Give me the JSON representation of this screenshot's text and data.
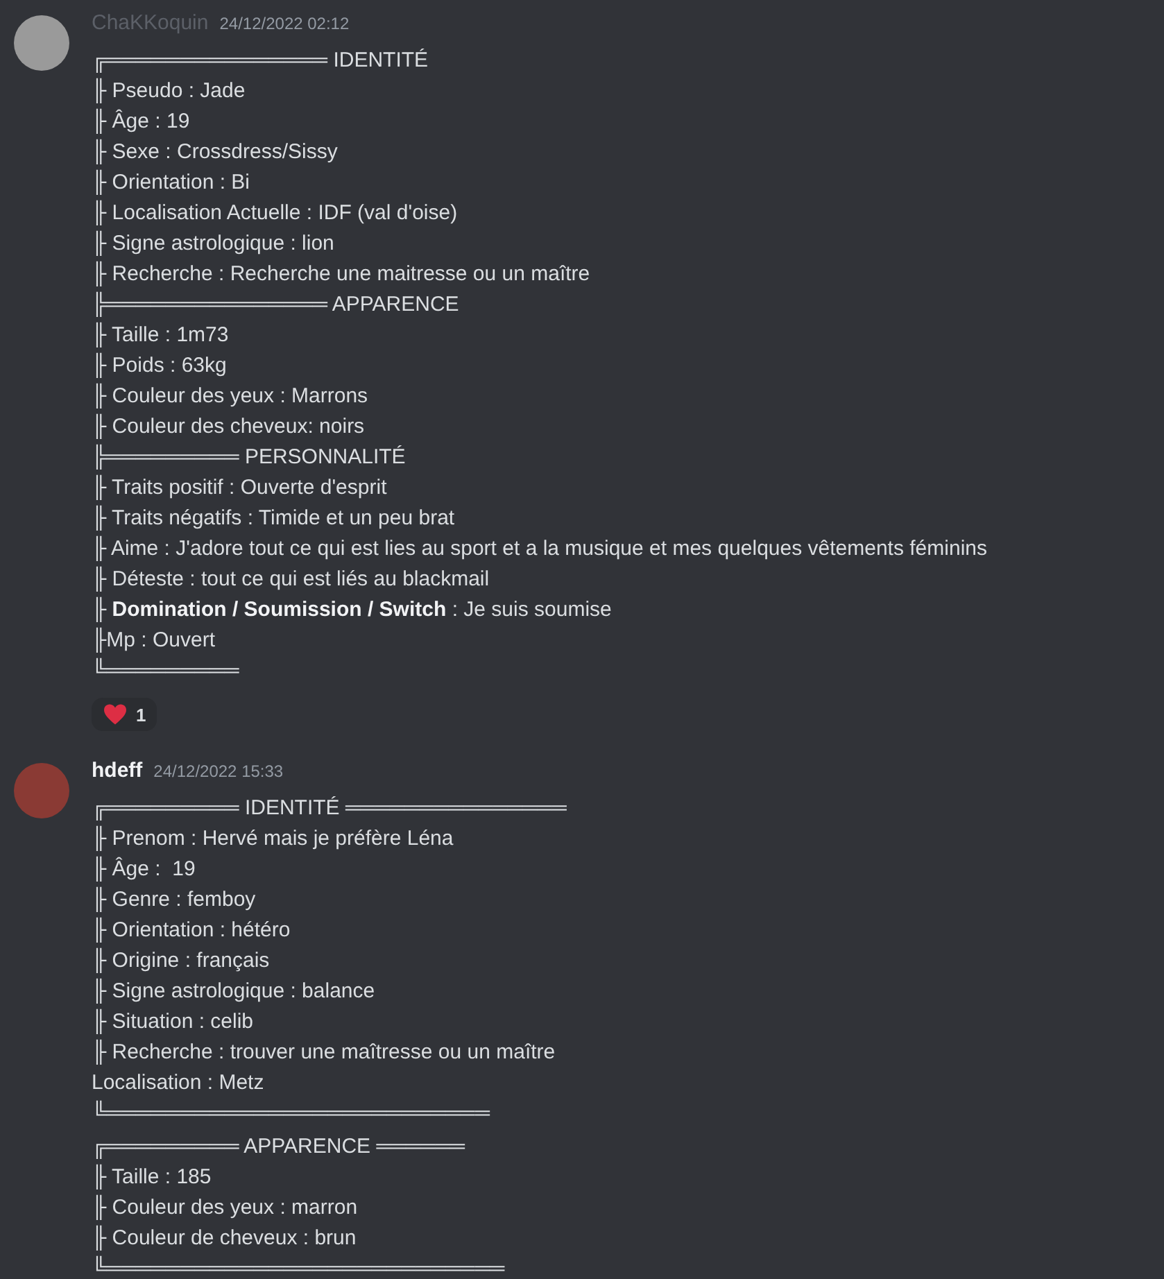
{
  "messages": [
    {
      "author": "ChaKKoquin",
      "author_dimmed": true,
      "timestamp": "24/12/2022 02:12",
      "paragraphs": [
        [
          "╔═══════════════ IDENTITÉ",
          "╟ Pseudo : Jade",
          "╟ Âge : 19",
          "╟ Sexe : Crossdress/Sissy",
          "╟ Orientation : Bi",
          "╟ Localisation Actuelle : IDF (val d'oise)",
          "╟ Signe astrologique : lion",
          "╟ Recherche : Recherche une maitresse ou un maître",
          "╠═══════════════ APPARENCE",
          "╟ Taille : 1m73",
          "╟ Poids : 63kg",
          "╟ Couleur des yeux : Marrons",
          "╟ Couleur des cheveux: noirs",
          "╠═════════ PERSONNALITÉ",
          "╟ Traits positif : Ouverte d'esprit",
          "╟ Traits négatifs : Timide et un peu brat",
          "╟ Aime : J'adore tout ce qui est lies au sport et a la musique et mes quelques vêtements féminins",
          "╟ Déteste : tout ce qui est liés au blackmail",
          "╟ **Domination / Soumission / Switch** : Je suis soumise",
          "╟Mp : Ouvert",
          "╚═════════"
        ]
      ],
      "reactions": [
        {
          "count": "1"
        }
      ]
    },
    {
      "author": "hdeff",
      "author_dimmed": false,
      "timestamp": "24/12/2022 15:33",
      "paragraphs": [
        [
          "╔═════════ IDENTITÉ ═══════════════",
          "╟ Prenom : Hervé mais je préfère Léna",
          "╟ Âge :  19",
          "╟ Genre : femboy",
          "╟ Orientation : hétéro",
          "╟ Origine : français",
          "╟ Signe astrologique : balance",
          "╟ Situation : celib",
          "╟ Recherche : trouver une maîtresse ou un maître",
          "Localisation : Metz",
          "╚══════════════════════════"
        ],
        [
          "╔═════════ APPARENCE ══════",
          "╟ Taille : 185",
          "╟ Couleur des yeux : marron",
          "╟ Couleur de cheveux : brun",
          "╚═══════════════════════════"
        ]
      ]
    }
  ]
}
